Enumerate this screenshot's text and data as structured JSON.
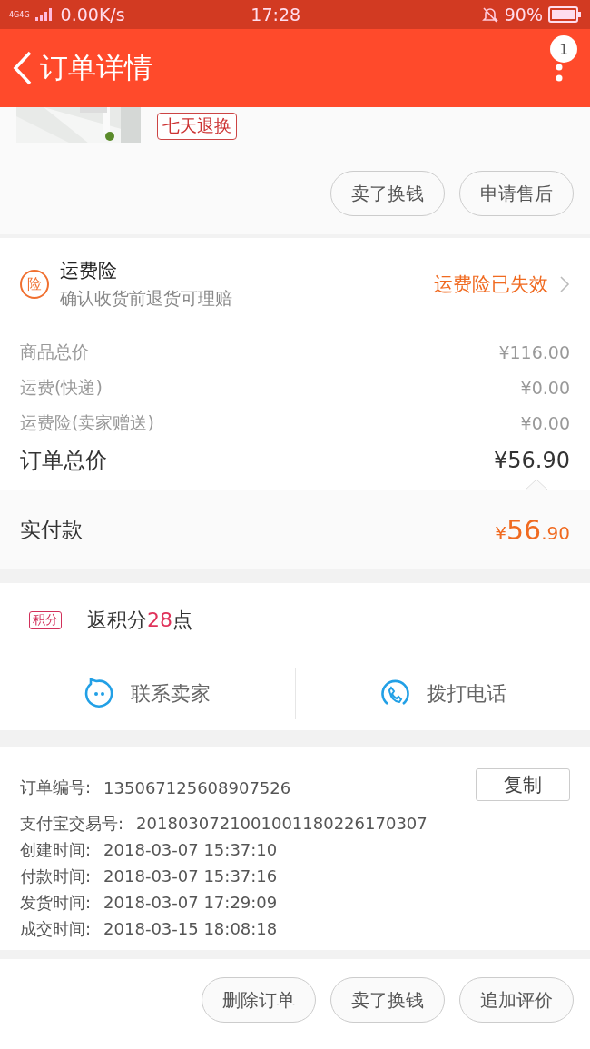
{
  "status_bar": {
    "network": "4G4G",
    "speed": "0.00K/s",
    "time": "17:28",
    "battery": "90%"
  },
  "nav": {
    "title": "订单详情",
    "badge": "1"
  },
  "product": {
    "image": {
      "kind": "picture"
    },
    "tag": "七天退换",
    "buttons": [
      "卖了换钱",
      "申请售后"
    ]
  },
  "insurance": {
    "badge": "险",
    "title": "运费险",
    "subtitle": "确认收货前退货可理赔",
    "status": "运费险已失效"
  },
  "price_rows": [
    {
      "label": "商品总价",
      "value": "¥116.00",
      "kind": "minor"
    },
    {
      "label": "运费(快递)",
      "value": "¥0.00",
      "kind": "minor"
    },
    {
      "label": "运费险(卖家赠送)",
      "value": "¥0.00",
      "kind": "minor"
    },
    {
      "label": "订单总价",
      "value": "¥56.90",
      "kind": "total"
    }
  ],
  "paid": {
    "label": "实付款",
    "currency": "¥",
    "integer": "56",
    "fraction": ".90"
  },
  "points": {
    "badge": "积分",
    "prefix": "返积分",
    "number": "28",
    "suffix": "点"
  },
  "contact": [
    {
      "label": "联系卖家",
      "kind": "chat"
    },
    {
      "label": "拨打电话",
      "kind": "phone"
    }
  ],
  "order_info": {
    "copy_button": "复制",
    "rows": [
      {
        "label": "订单编号:",
        "value": "135067125608907526"
      },
      {
        "label": "支付宝交易号:",
        "value": "2018030721001001180226170307"
      },
      {
        "label": "创建时间:",
        "value": "2018-03-07 15:37:10"
      },
      {
        "label": "付款时间:",
        "value": "2018-03-07 15:37:16"
      },
      {
        "label": "发货时间:",
        "value": "2018-03-07 17:29:09"
      },
      {
        "label": "成交时间:",
        "value": "2018-03-15 18:08:18"
      }
    ]
  },
  "bottom_buttons": [
    "删除订单",
    "卖了换钱",
    "追加评价"
  ]
}
